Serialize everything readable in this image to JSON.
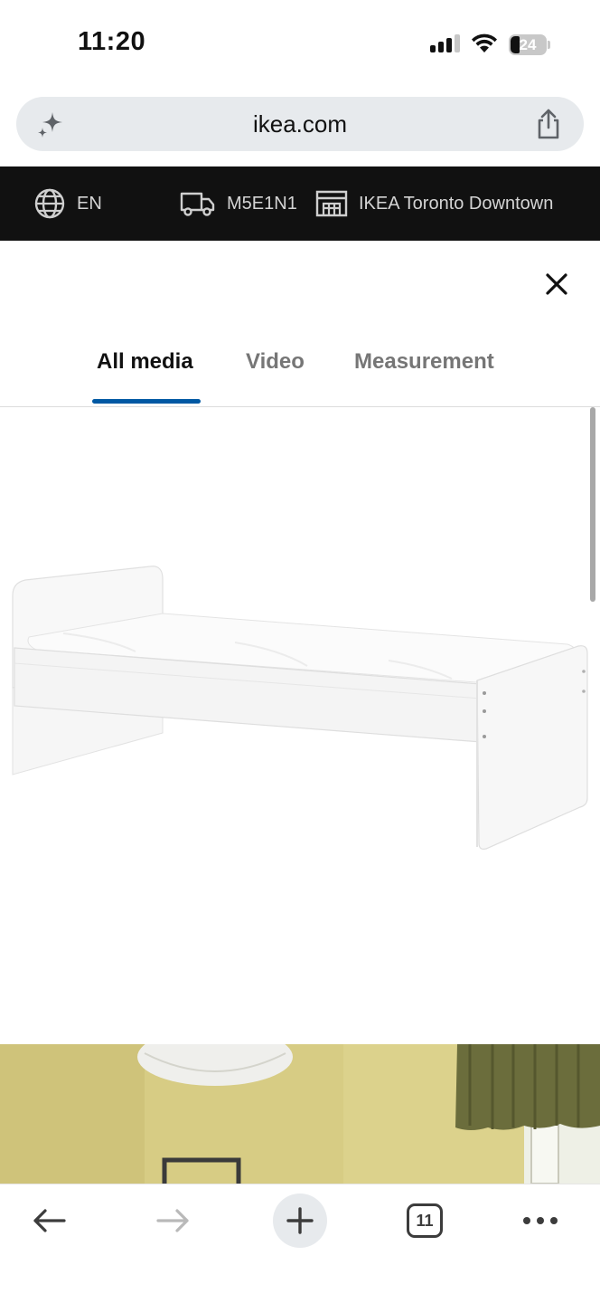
{
  "status": {
    "time": "11:20",
    "battery": "24"
  },
  "browser": {
    "url": "ikea.com",
    "open_tabs": "11"
  },
  "ikea_header": {
    "language": "EN",
    "postal_code": "M5E1N1",
    "store": "IKEA Toronto Downtown"
  },
  "media_viewer": {
    "tabs": [
      {
        "label": "All media",
        "active": true
      },
      {
        "label": "Video",
        "active": false
      },
      {
        "label": "Measurement",
        "active": false
      }
    ]
  },
  "colors": {
    "accent": "#0058a3",
    "header_bg": "#111111"
  },
  "icons": [
    "sparkle-icon",
    "share-icon",
    "globe-icon",
    "truck-icon",
    "store-icon",
    "close-icon",
    "back-arrow-icon",
    "forward-arrow-icon",
    "plus-icon",
    "tabs-icon",
    "more-icon"
  ]
}
